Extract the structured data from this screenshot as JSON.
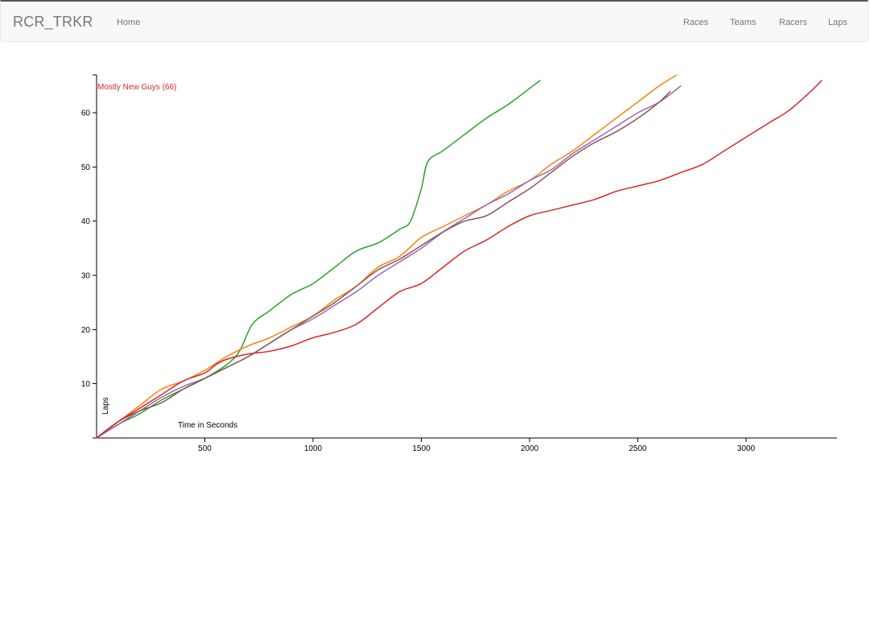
{
  "navbar": {
    "brand": "RCR_TRKR",
    "home": "Home",
    "races": "Races",
    "teams": "Teams",
    "racers": "Racers",
    "laps": "Laps"
  },
  "chart_data": {
    "type": "line",
    "xlabel": "Time in Seconds",
    "ylabel": "Laps",
    "xlim": [
      0,
      3420
    ],
    "ylim": [
      0,
      67
    ],
    "xticks": [
      500,
      1000,
      1500,
      2000,
      2500,
      3000
    ],
    "yticks": [
      10,
      20,
      30,
      40,
      50,
      60
    ],
    "hover_label": "Mostly New Guys (66)",
    "series": [
      {
        "color": "#2ca02c",
        "points": [
          [
            0,
            0
          ],
          [
            100,
            2.5
          ],
          [
            200,
            4.5
          ],
          [
            300,
            7
          ],
          [
            400,
            9
          ],
          [
            500,
            11
          ],
          [
            600,
            13.5
          ],
          [
            660,
            16
          ],
          [
            720,
            21
          ],
          [
            800,
            23.5
          ],
          [
            900,
            26.5
          ],
          [
            1000,
            28.5
          ],
          [
            1100,
            31.5
          ],
          [
            1200,
            34.5
          ],
          [
            1300,
            36
          ],
          [
            1400,
            38.5
          ],
          [
            1450,
            40
          ],
          [
            1500,
            46
          ],
          [
            1530,
            51
          ],
          [
            1600,
            53
          ],
          [
            1700,
            56
          ],
          [
            1800,
            59
          ],
          [
            1900,
            61.5
          ],
          [
            2000,
            64.5
          ],
          [
            2050,
            66
          ]
        ]
      },
      {
        "color": "#ff7f0e",
        "points": [
          [
            0,
            0
          ],
          [
            100,
            3
          ],
          [
            200,
            6
          ],
          [
            300,
            9
          ],
          [
            400,
            10.5
          ],
          [
            500,
            12.5
          ],
          [
            600,
            15
          ],
          [
            700,
            17
          ],
          [
            800,
            18.5
          ],
          [
            900,
            20.5
          ],
          [
            1000,
            22.5
          ],
          [
            1100,
            25.5
          ],
          [
            1200,
            28
          ],
          [
            1300,
            31.5
          ],
          [
            1400,
            33.5
          ],
          [
            1500,
            37
          ],
          [
            1600,
            39
          ],
          [
            1700,
            41
          ],
          [
            1800,
            43
          ],
          [
            1900,
            45.5
          ],
          [
            2000,
            47.5
          ],
          [
            2100,
            50.5
          ],
          [
            2200,
            53
          ],
          [
            2300,
            56
          ],
          [
            2400,
            59
          ],
          [
            2500,
            62
          ],
          [
            2600,
            65
          ],
          [
            2680,
            67
          ]
        ]
      },
      {
        "color": "#9467bd",
        "points": [
          [
            0,
            0
          ],
          [
            100,
            2.5
          ],
          [
            200,
            5
          ],
          [
            300,
            7.5
          ],
          [
            400,
            9.5
          ],
          [
            500,
            11
          ],
          [
            600,
            13
          ],
          [
            700,
            15
          ],
          [
            800,
            17.5
          ],
          [
            900,
            20
          ],
          [
            1000,
            22
          ],
          [
            1100,
            24.5
          ],
          [
            1200,
            27
          ],
          [
            1300,
            30
          ],
          [
            1400,
            32.5
          ],
          [
            1500,
            35
          ],
          [
            1600,
            38
          ],
          [
            1700,
            40.5
          ],
          [
            1800,
            43
          ],
          [
            1900,
            45
          ],
          [
            2000,
            47.5
          ],
          [
            2100,
            49.5
          ],
          [
            2200,
            52.5
          ],
          [
            2300,
            55
          ],
          [
            2400,
            57.5
          ],
          [
            2500,
            60
          ],
          [
            2600,
            62
          ],
          [
            2700,
            65
          ]
        ]
      },
      {
        "color": "#8c564b",
        "points": [
          [
            0,
            0
          ],
          [
            100,
            3
          ],
          [
            200,
            5
          ],
          [
            300,
            6.5
          ],
          [
            400,
            9
          ],
          [
            500,
            11
          ],
          [
            600,
            13
          ],
          [
            700,
            15
          ],
          [
            800,
            17.5
          ],
          [
            900,
            20
          ],
          [
            1000,
            22.5
          ],
          [
            1100,
            25
          ],
          [
            1200,
            28
          ],
          [
            1300,
            31
          ],
          [
            1400,
            33
          ],
          [
            1500,
            35.5
          ],
          [
            1600,
            38
          ],
          [
            1700,
            40
          ],
          [
            1800,
            41
          ],
          [
            1900,
            43.5
          ],
          [
            2000,
            46
          ],
          [
            2100,
            49
          ],
          [
            2200,
            52
          ],
          [
            2300,
            54.5
          ],
          [
            2400,
            56.5
          ],
          [
            2500,
            59
          ],
          [
            2600,
            62
          ],
          [
            2650,
            64
          ]
        ]
      },
      {
        "color": "#d62728",
        "points": [
          [
            0,
            0
          ],
          [
            100,
            3
          ],
          [
            200,
            5.5
          ],
          [
            300,
            8
          ],
          [
            400,
            10.5
          ],
          [
            500,
            12
          ],
          [
            550,
            13.5
          ],
          [
            600,
            14.5
          ],
          [
            700,
            15.5
          ],
          [
            800,
            16
          ],
          [
            900,
            17
          ],
          [
            1000,
            18.5
          ],
          [
            1100,
            19.5
          ],
          [
            1200,
            21
          ],
          [
            1300,
            24
          ],
          [
            1400,
            27
          ],
          [
            1500,
            28.5
          ],
          [
            1600,
            31.5
          ],
          [
            1700,
            34.5
          ],
          [
            1800,
            36.5
          ],
          [
            1900,
            39
          ],
          [
            2000,
            41
          ],
          [
            2100,
            42
          ],
          [
            2200,
            43
          ],
          [
            2300,
            44
          ],
          [
            2400,
            45.5
          ],
          [
            2500,
            46.5
          ],
          [
            2600,
            47.5
          ],
          [
            2700,
            49
          ],
          [
            2800,
            50.5
          ],
          [
            2900,
            53
          ],
          [
            3000,
            55.5
          ],
          [
            3100,
            58
          ],
          [
            3200,
            60.5
          ],
          [
            3300,
            64
          ],
          [
            3350,
            66
          ]
        ]
      }
    ]
  }
}
